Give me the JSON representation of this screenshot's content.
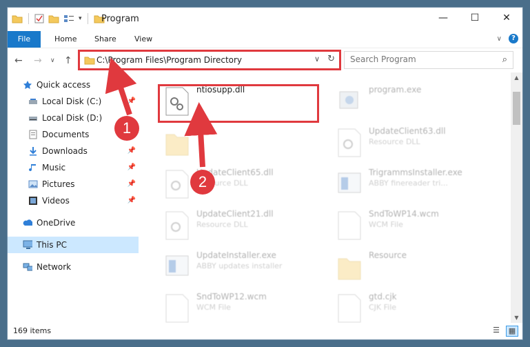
{
  "window": {
    "title": "Program"
  },
  "ribbon": {
    "tabs": [
      "File",
      "Home",
      "Share",
      "View"
    ],
    "help": "?"
  },
  "address": {
    "path": "C:\\Program Files\\Program Directory"
  },
  "search": {
    "placeholder": "Search Program"
  },
  "nav": {
    "items": [
      {
        "label": "Quick access"
      },
      {
        "label": "Local Disk (C:)"
      },
      {
        "label": "Local Disk (D:)"
      },
      {
        "label": "Documents"
      },
      {
        "label": "Downloads"
      },
      {
        "label": "Music"
      },
      {
        "label": "Pictures"
      },
      {
        "label": "Videos"
      },
      {
        "label": "OneDrive"
      },
      {
        "label": "This PC"
      },
      {
        "label": "Network"
      }
    ]
  },
  "files": [
    {
      "name": "ntiosupp.dll",
      "type": ""
    },
    {
      "name": "program.exe",
      "type": ""
    },
    {
      "name": "UpdateClient63.dll",
      "type": "Resource DLL"
    },
    {
      "name": "UpdateClient65.dll",
      "type": "Resource DLL"
    },
    {
      "name": "TrigrammsInstaller.exe",
      "type": "ABBY finereader tri..."
    },
    {
      "name": "UpdateClient21.dll",
      "type": "Resource DLL"
    },
    {
      "name": "SndToWP14.wcm",
      "type": "WCM File"
    },
    {
      "name": "UpdateInstaller.exe",
      "type": "ABBY updates installer"
    },
    {
      "name": "Resource",
      "type": ""
    },
    {
      "name": "SndToWP12.wcm",
      "type": "WCM File"
    },
    {
      "name": "gtd.cjk",
      "type": "CJK File"
    }
  ],
  "status": {
    "count": "169 items"
  },
  "annotations": {
    "step1": "1",
    "step2": "2",
    "accent": "#e0393e"
  }
}
